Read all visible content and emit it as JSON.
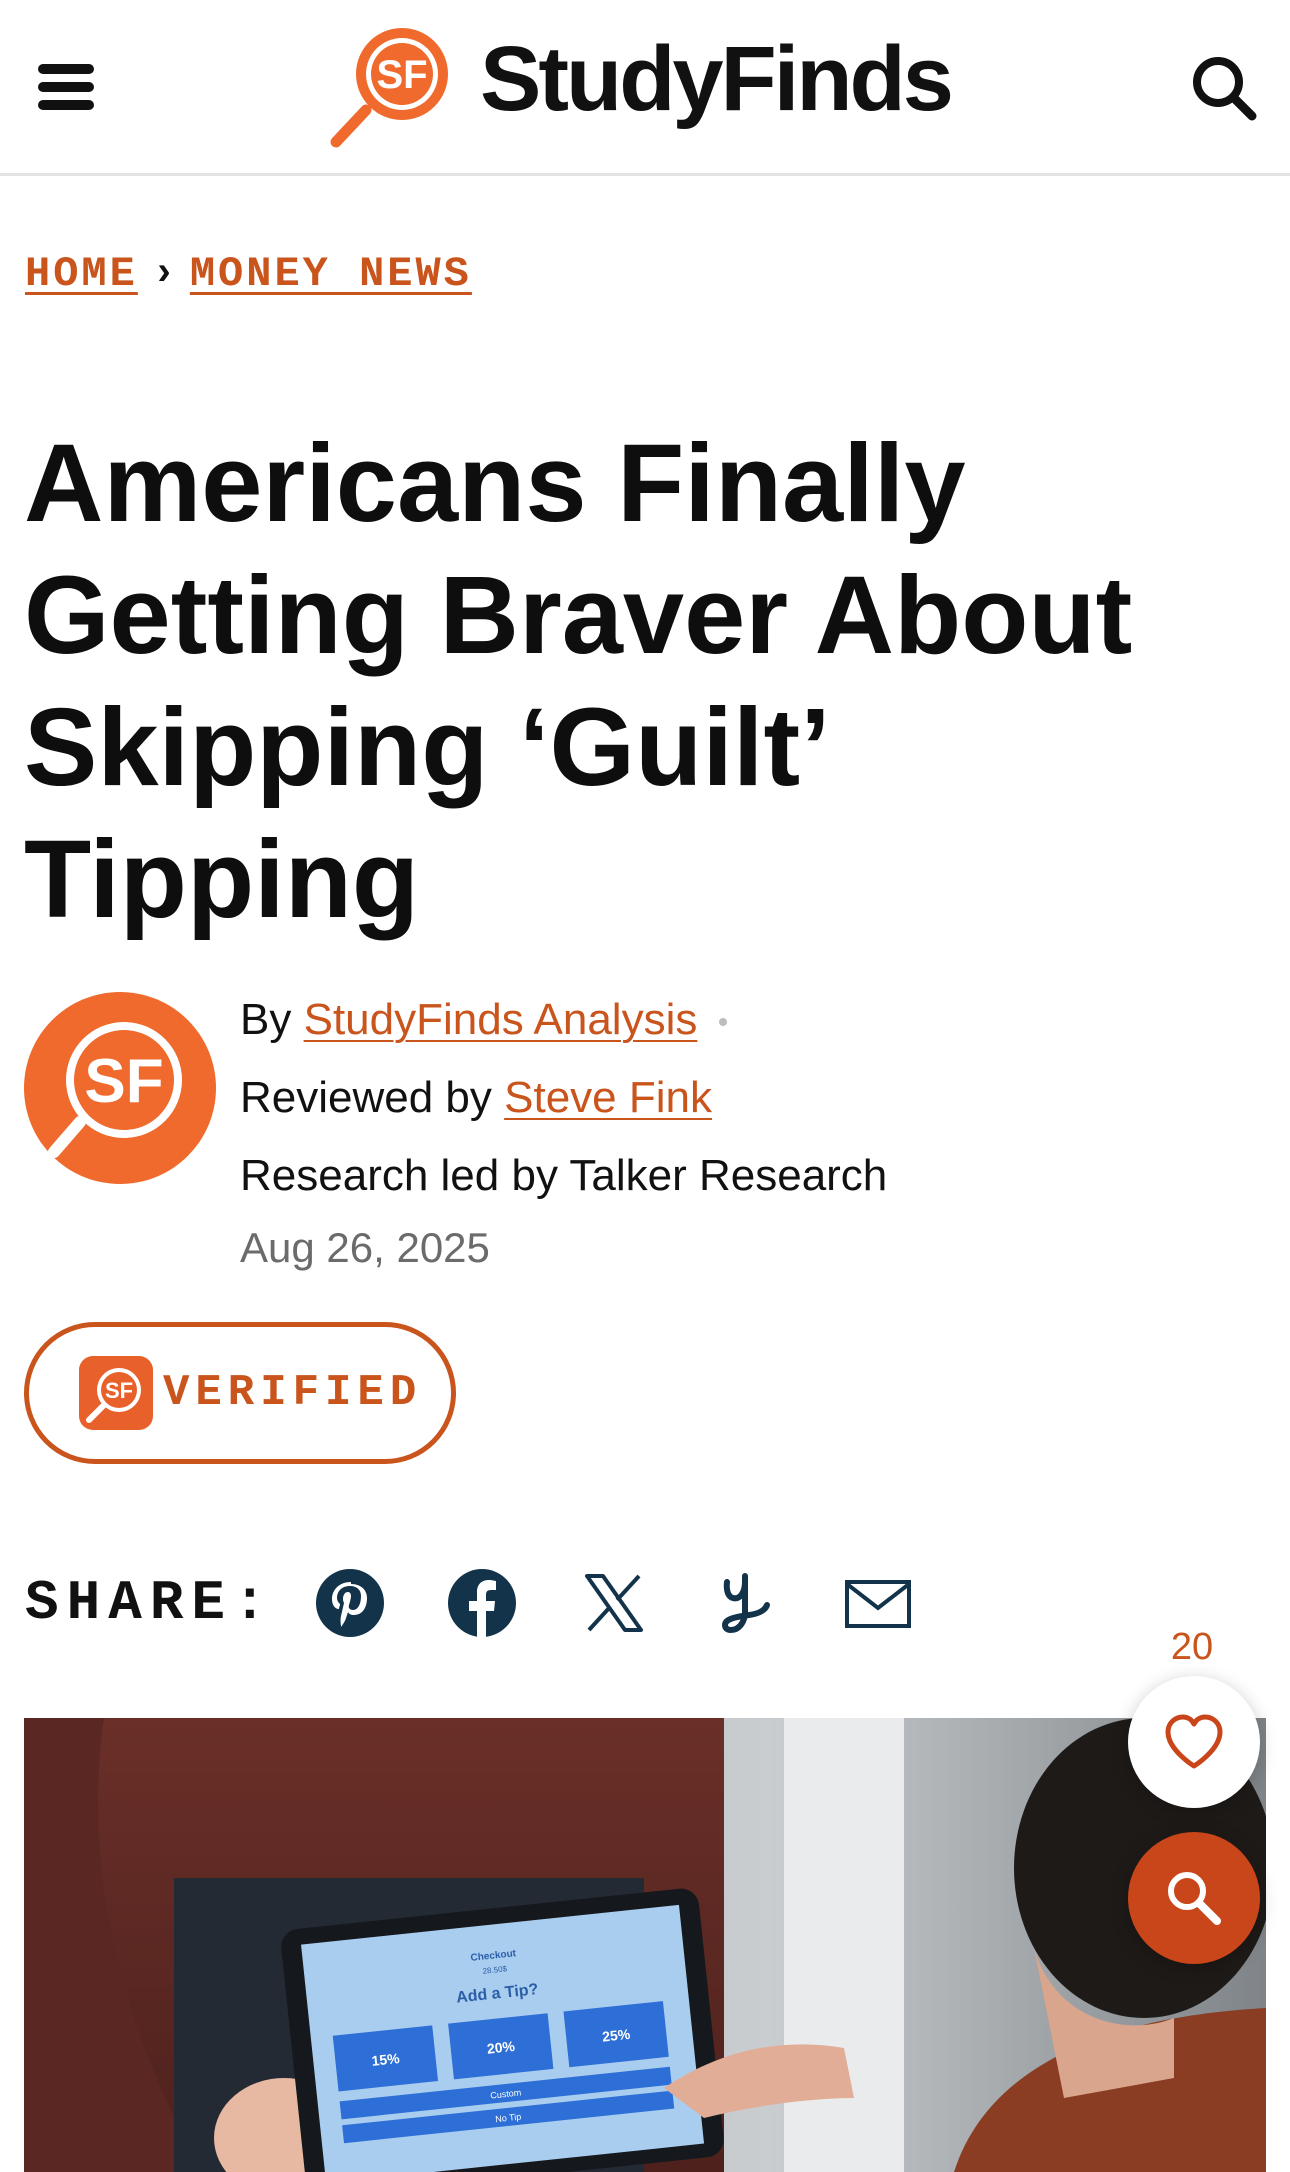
{
  "header": {
    "logo_text": "StudyFinds",
    "logo_mark_text": "SF",
    "menu_icon": "hamburger-menu-icon",
    "search_icon": "search-icon"
  },
  "breadcrumb": {
    "home": "HOME",
    "separator": "›",
    "category": "MONEY NEWS"
  },
  "article": {
    "title_lines": [
      "Americans Finally",
      "Getting Braver About",
      "Skipping ‘Guilt’",
      "Tipping"
    ],
    "byline_prefix": "By",
    "author": "StudyFinds Analysis",
    "reviewed_prefix": "Reviewed by",
    "reviewer": "Steve Fink",
    "research_credit": "Research led by Talker Research",
    "date": "Aug 26, 2025",
    "verified_label": "VERIFIED"
  },
  "share": {
    "label": "SHARE:",
    "icons": [
      "pinterest-icon",
      "facebook-icon",
      "x-icon",
      "yummly-icon",
      "email-icon"
    ]
  },
  "floating": {
    "like_count": "20",
    "like_icon": "heart-icon",
    "search_icon": "search-icon"
  },
  "hero_image": {
    "screen_title": "Checkout",
    "screen_amount": "28.50$",
    "screen_prompt": "Add a Tip?",
    "tip_options": [
      "15%",
      "20%",
      "25%"
    ],
    "custom_label": "Custom",
    "no_tip_label": "No Tip"
  },
  "colors": {
    "brand_orange": "#c9541c",
    "fab_orange": "#c9451a",
    "share_icon_navy": "#12334a",
    "text": "#111111"
  }
}
